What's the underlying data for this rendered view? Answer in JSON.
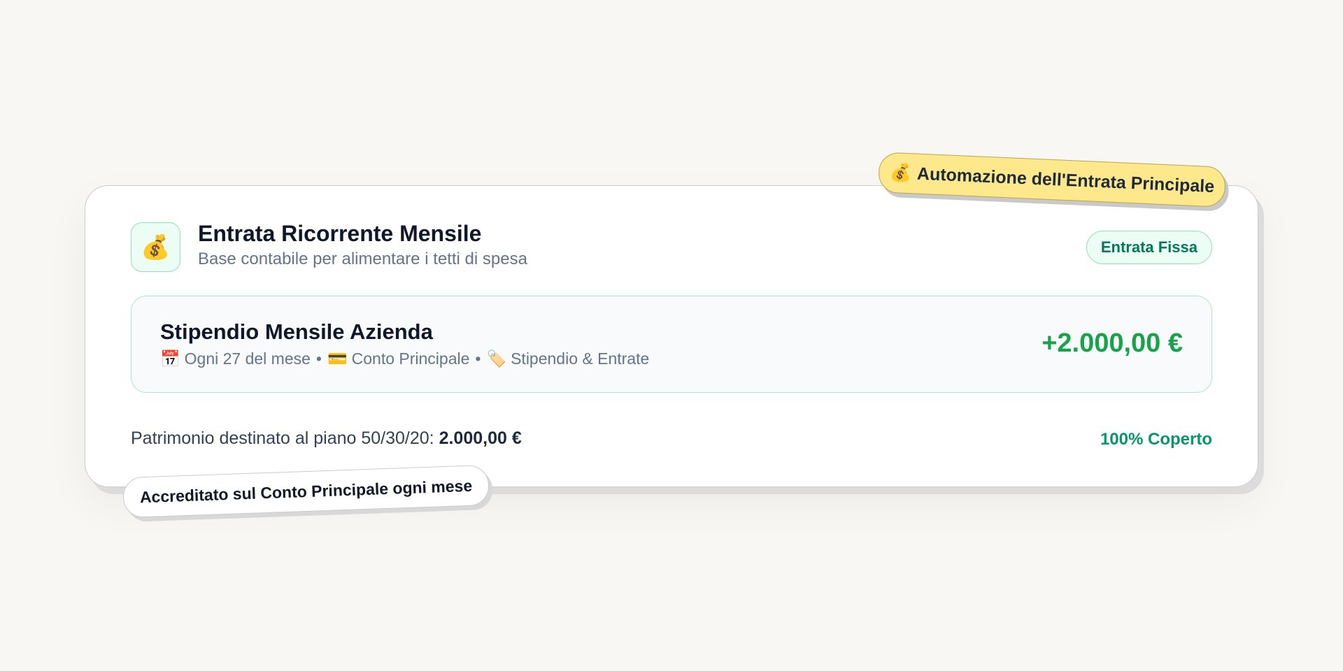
{
  "sticker_top": {
    "icon": "money-bag-icon",
    "emoji": "💰",
    "label": "Automazione dell'Entrata Principale"
  },
  "header": {
    "icon": "money-bag-icon",
    "emoji": "💰",
    "title": "Entrata Ricorrente Mensile",
    "subtitle": "Base contabile per alimentare i tetti di spesa",
    "badge": "Entrata Fissa"
  },
  "income": {
    "title": "Stipendio Mensile Azienda",
    "meta": [
      {
        "icon": "calendar-icon",
        "emoji": "📅",
        "text": "Ogni 27 del mese"
      },
      {
        "icon": "credit-card-icon",
        "emoji": "💳",
        "text": "Conto Principale"
      },
      {
        "icon": "tag-icon",
        "emoji": "🏷️",
        "text": "Stipendio & Entrate"
      }
    ],
    "separator": "•",
    "amount": "+2.000,00 €"
  },
  "footer": {
    "label": "Patrimonio destinato al piano 50/30/20:",
    "value": "2.000,00 €",
    "status": "100% Coperto"
  },
  "sticker_bottom": {
    "label": "Accreditato sul Conto Principale ogni mese"
  },
  "colors": {
    "accent_green": "#16a34a",
    "status_green": "#059669",
    "sticker_yellow": "#fde98c",
    "page_bg": "#f9f7f3"
  }
}
